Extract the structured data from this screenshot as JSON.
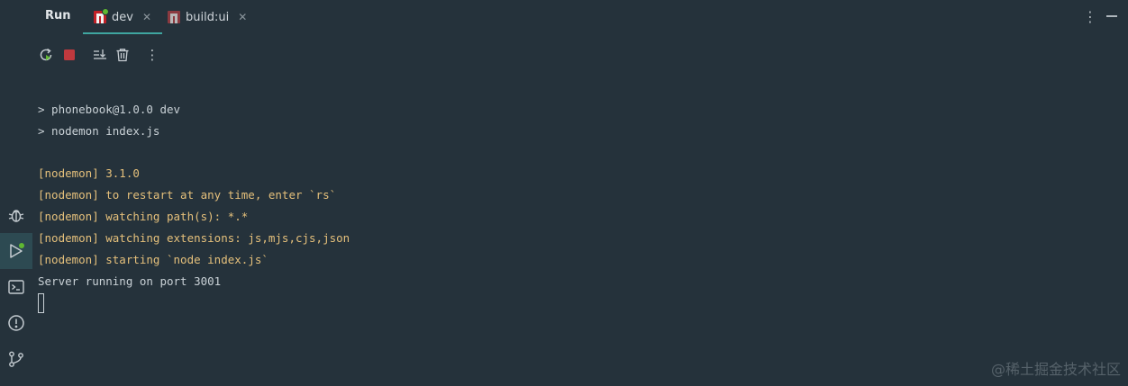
{
  "tabbar": {
    "run_label": "Run",
    "tabs": [
      {
        "label": "dev",
        "icon": "npm-icon",
        "active": true,
        "close": "✕"
      },
      {
        "label": "build:ui",
        "icon": "npm-icon",
        "active": false,
        "close": "✕"
      }
    ],
    "more_icon": "⋮"
  },
  "toolbar": {
    "buttons": [
      {
        "name": "rerun-icon"
      },
      {
        "name": "stop-icon"
      },
      {
        "name": "scroll-to-end-icon"
      },
      {
        "name": "clear-all-icon"
      },
      {
        "name": "more-vertical-icon",
        "glyph": "⋮"
      }
    ]
  },
  "sidebar": {
    "items": [
      {
        "name": "debug-icon"
      },
      {
        "name": "run-icon",
        "active": true
      },
      {
        "name": "terminal-icon"
      },
      {
        "name": "problems-icon"
      },
      {
        "name": "git-icon"
      }
    ]
  },
  "console": {
    "lines": [
      "> phonebook@1.0.0 dev",
      "> nodemon index.js",
      "",
      "[nodemon] 3.1.0",
      "[nodemon] to restart at any time, enter `rs`",
      "[nodemon] watching path(s): *.*",
      "[nodemon] watching extensions: js,mjs,cjs,json",
      "[nodemon] starting `node index.js`",
      "Server running on port 3001"
    ]
  },
  "colors": {
    "background": "#25323b",
    "accent": "#3fa6a0",
    "nodemon_text": "#e5c07b",
    "plain_text": "#c9d1d6",
    "npm_red": "#c12127",
    "running_dot": "#5fb832"
  },
  "watermark": "@稀土掘金技术社区"
}
